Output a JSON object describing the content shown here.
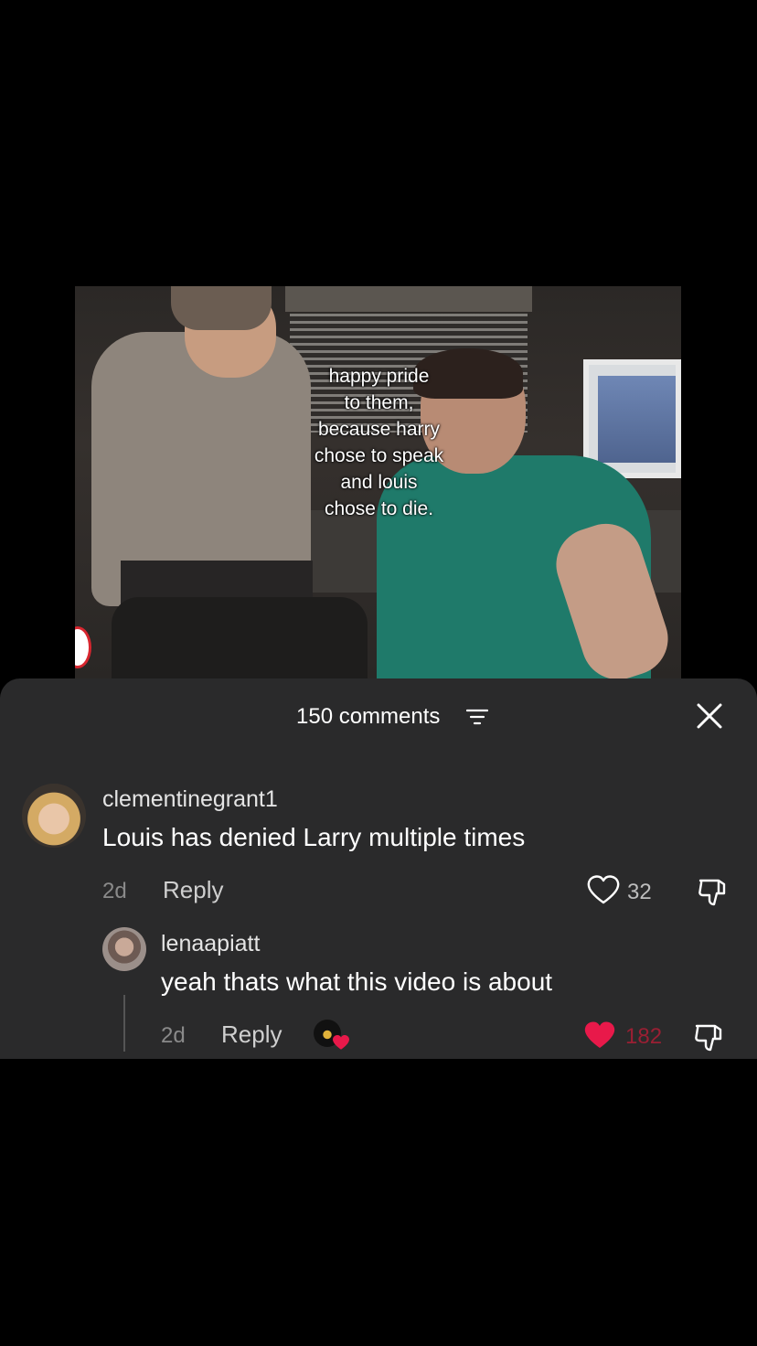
{
  "video": {
    "caption": "happy pride\nto them,\nbecause harry\nchose to speak\nand louis\nchose to die."
  },
  "comments_panel": {
    "count_label": "150 comments",
    "filter_icon": "filter-icon",
    "close_icon": "close-icon"
  },
  "comments": [
    {
      "username": "clementinegrant1",
      "text": "Louis has denied Larry multiple times",
      "time": "2d",
      "reply_label": "Reply",
      "likes": "32",
      "liked": false
    }
  ],
  "replies": [
    {
      "username": "lenaapiatt",
      "text": "yeah thats what this video is about",
      "time": "2d",
      "reply_label": "Reply",
      "likes": "182",
      "liked": true,
      "liked_by_creator": true
    }
  ],
  "colors": {
    "like_red": "#e8194a",
    "sheet_bg": "#2a2a2b"
  }
}
